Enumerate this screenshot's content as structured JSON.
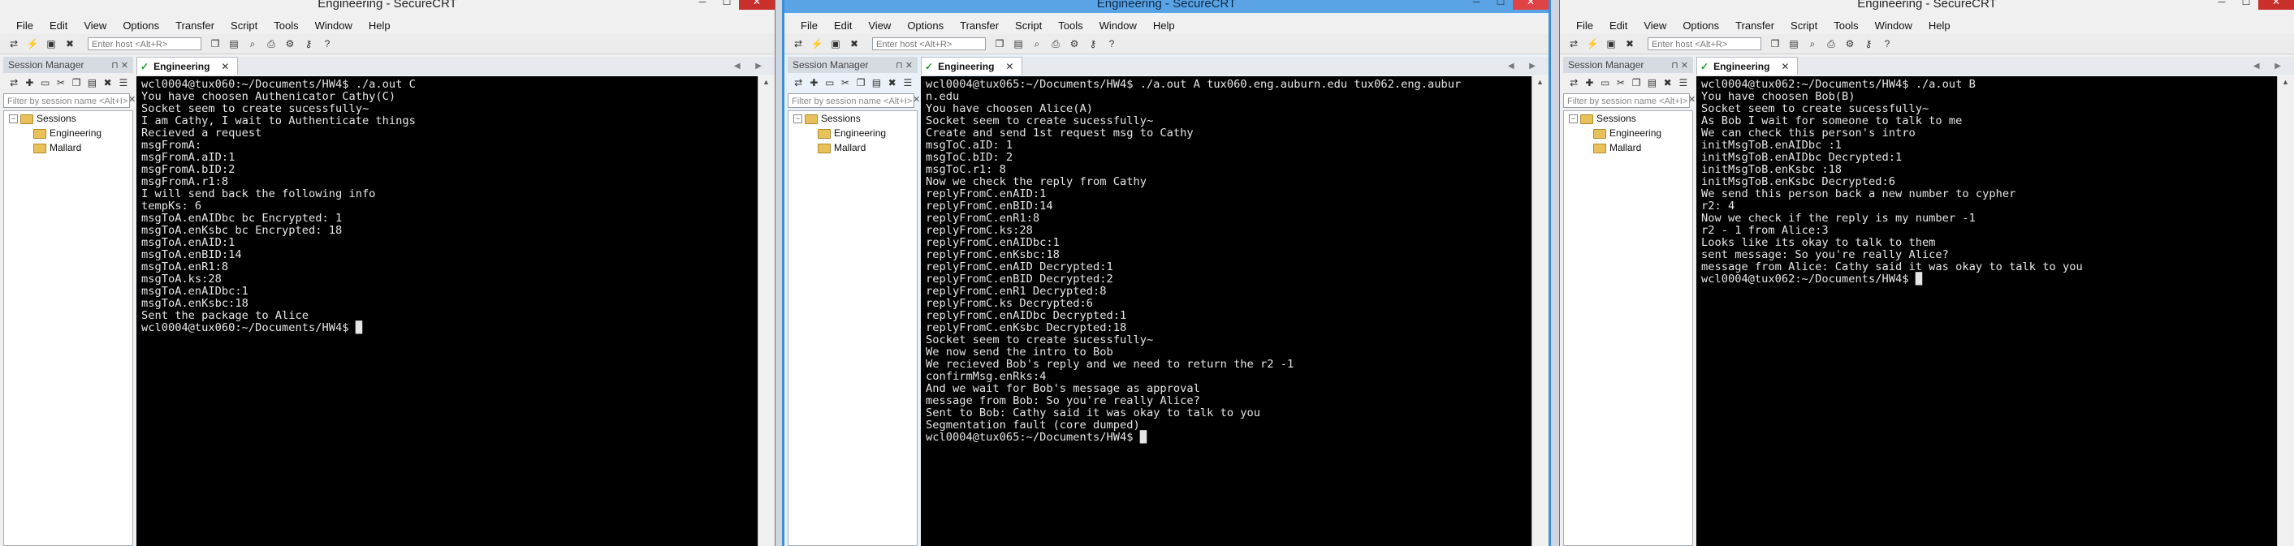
{
  "app_title": "Engineering - SecureCRT",
  "window_controls": {
    "minimize": "─",
    "maximize": "☐",
    "close": "✕"
  },
  "menus": [
    "File",
    "Edit",
    "View",
    "Options",
    "Transfer",
    "Script",
    "Tools",
    "Window",
    "Help"
  ],
  "host_placeholder": "Enter host <Alt+R>",
  "session_manager": {
    "title": "Session Manager",
    "controls": "⊓ ✕",
    "filter_placeholder": "Filter by session name <Alt+I>",
    "filter_clear": "✕",
    "tree": {
      "root": "Sessions",
      "toggle": "−",
      "items": [
        "Engineering",
        "Mallard"
      ]
    }
  },
  "tab": {
    "label": "Engineering",
    "check": "✓",
    "close": "✕",
    "nav": "◀ ▶"
  },
  "windows": [
    {
      "terminal": "wcl0004@tux060:~/Documents/HW4$ ./a.out C\nYou have choosen Authenicator Cathy(C)\nSocket seem to create sucessfully~\nI am Cathy, I wait to Authenticate things\nRecieved a request\nmsgFromA:\nmsgFromA.aID:1\nmsgFromA.bID:2\nmsgFromA.r1:8\nI will send back the following info\ntempKs: 6\nmsgToA.enAIDbc bc Encrypted: 1\nmsgToA.enKsbc bc Encrypted: 18\nmsgToA.enAID:1\nmsgToA.enBID:14\nmsgToA.enR1:8\nmsgToA.ks:28\nmsgToA.enAIDbc:1\nmsgToA.enKsbc:18\nSent the package to Alice\nwcl0004@tux060:~/Documents/HW4$ █"
    },
    {
      "terminal": "wcl0004@tux065:~/Documents/HW4$ ./a.out A tux060.eng.auburn.edu tux062.eng.aubur\nn.edu\nYou have choosen Alice(A)\nSocket seem to create sucessfully~\nCreate and send 1st request msg to Cathy\nmsgToC.aID: 1\nmsgToC.bID: 2\nmsgToC.r1: 8\nNow we check the reply from Cathy\nreplyFromC.enAID:1\nreplyFromC.enBID:14\nreplyFromC.enR1:8\nreplyFromC.ks:28\nreplyFromC.enAIDbc:1\nreplyFromC.enKsbc:18\nreplyFromC.enAID Decrypted:1\nreplyFromC.enBID Decrypted:2\nreplyFromC.enR1 Decrypted:8\nreplyFromC.ks Decrypted:6\nreplyFromC.enAIDbc Decrypted:1\nreplyFromC.enKsbc Decrypted:18\nSocket seem to create sucessfully~\nWe now send the intro to Bob\nWe recieved Bob's reply and we need to return the r2 -1\nconfirmMsg.enRks:4\nAnd we wait for Bob's message as approval\nmessage from Bob: So you're really Alice?\nSent to Bob: Cathy said it was okay to talk to you\nSegmentation fault (core dumped)\nwcl0004@tux065:~/Documents/HW4$ █"
    },
    {
      "terminal": "wcl0004@tux062:~/Documents/HW4$ ./a.out B\nYou have choosen Bob(B)\nSocket seem to create sucessfully~\nAs Bob I wait for someone to talk to me\nWe can check this person's intro\ninitMsgToB.enAIDbc :1\ninitMsgToB.enAIDbc Decrypted:1\ninitMsgToB.enKsbc :18\ninitMsgToB.enKsbc Decrypted:6\nWe send this person back a new number to cypher\nr2: 4\nNow we check if the reply is my number -1\nr2 - 1 from Alice:3\nLooks like its okay to talk to them\nsent message: So you're really Alice?\nmessage from Alice: Cathy said it was okay to talk to you\nwcl0004@tux062:~/Documents/HW4$ █"
    }
  ],
  "colors": {
    "active_border": "#3a8fd8",
    "terminal_bg": "#000000",
    "terminal_fg": "#e6e6e6",
    "close_button": "#c9302c"
  }
}
